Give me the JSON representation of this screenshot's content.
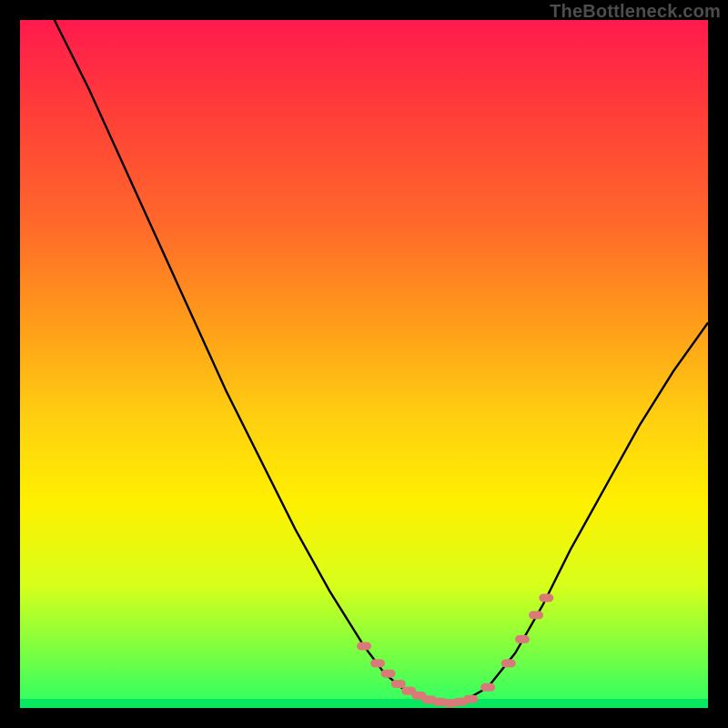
{
  "watermark": "TheBottleneck.com",
  "colors": {
    "background": "#000000",
    "curve": "#000000",
    "marker": "#d97a78",
    "gradient_top": "#ff1a4d",
    "gradient_bottom": "#2aff66"
  },
  "chart_data": {
    "type": "line",
    "title": "",
    "xlabel": "",
    "ylabel": "",
    "xlim": [
      0,
      100
    ],
    "ylim": [
      0,
      100
    ],
    "grid": false,
    "series": [
      {
        "name": "curve",
        "x": [
          5,
          10,
          15,
          20,
          25,
          30,
          35,
          40,
          45,
          50,
          53,
          56,
          59,
          62,
          65,
          68,
          72,
          76,
          80,
          85,
          90,
          95,
          100
        ],
        "y": [
          100,
          90,
          79,
          68,
          57,
          46,
          36,
          26,
          17,
          9,
          5,
          2.5,
          1.2,
          0.7,
          1.3,
          3,
          8,
          15,
          23,
          32,
          41,
          49,
          56
        ]
      }
    ],
    "markers": {
      "name": "highlight-dots",
      "x": [
        50,
        52,
        53.5,
        55,
        56.5,
        58,
        59.5,
        61,
        62.5,
        64,
        65.5,
        68,
        71,
        73,
        75,
        76.5
      ],
      "y": [
        9,
        6.5,
        5,
        3.5,
        2.5,
        1.8,
        1.2,
        0.9,
        0.7,
        0.9,
        1.3,
        3,
        6.5,
        10,
        13.5,
        16
      ]
    }
  }
}
